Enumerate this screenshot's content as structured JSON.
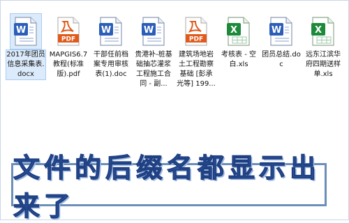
{
  "files": [
    {
      "name": "2017年团员信息采集表.docx",
      "type": "word",
      "icon": "word-doc-icon",
      "selected": true
    },
    {
      "name": "MAPGIS6.7教程(标准版).pdf",
      "type": "pdf",
      "icon": "pdf-icon",
      "selected": false
    },
    {
      "name": "干部任前档案专用审核表(1).doc",
      "type": "word",
      "icon": "word-doc-icon",
      "selected": false
    },
    {
      "name": "贵港补-桩基础抽芯灌浆工程施工合同 - 副...",
      "type": "word",
      "icon": "word-doc-icon",
      "selected": false
    },
    {
      "name": "建筑场地岩土工程勘察基础 [彭承光等] 199...",
      "type": "pdf",
      "icon": "pdf-icon",
      "selected": false
    },
    {
      "name": "考核表 - 空白.xls",
      "type": "excel",
      "icon": "excel-icon",
      "selected": false
    },
    {
      "name": "团员总结.doc",
      "type": "word",
      "icon": "word-doc-icon",
      "selected": false
    },
    {
      "name": "远东江滨华府四期送样单.xls",
      "type": "excel",
      "icon": "excel-icon",
      "selected": false
    }
  ],
  "banner": {
    "text": "文件的后缀名都显示出来了"
  },
  "colors": {
    "word": "#2b5eb8",
    "pdf": "#e05a1b",
    "excel": "#1d8a3b",
    "banner_text": "#2f58a8",
    "selection": "#dcebfb"
  }
}
